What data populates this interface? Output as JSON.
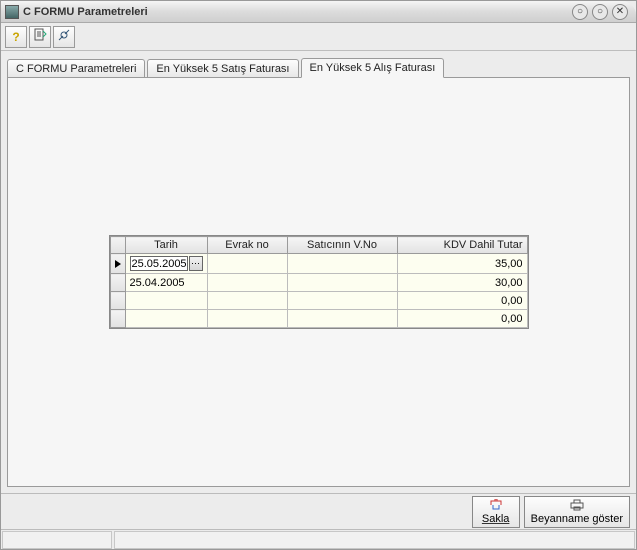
{
  "window": {
    "title": "C FORMU Parametreleri"
  },
  "toolbar": {
    "help": "?",
    "help_color": "#c9a400"
  },
  "tabs": {
    "t1": "C FORMU Parametreleri",
    "t2": "En Yüksek 5 Satış Faturası",
    "t3": "En Yüksek 5 Alış Faturası"
  },
  "grid": {
    "headers": {
      "tarih": "Tarih",
      "evrak": "Evrak no",
      "vno": "Satıcının V.No",
      "kdv": "KDV Dahil Tutar"
    },
    "rows": [
      {
        "tarih": "25.05.2005",
        "evrak": "",
        "vno": "",
        "kdv": "35,00",
        "active": true
      },
      {
        "tarih": "25.04.2005",
        "evrak": "",
        "vno": "",
        "kdv": "30,00",
        "active": false
      },
      {
        "tarih": "",
        "evrak": "",
        "vno": "",
        "kdv": "0,00",
        "active": false
      },
      {
        "tarih": "",
        "evrak": "",
        "vno": "",
        "kdv": "0,00",
        "active": false
      }
    ]
  },
  "buttons": {
    "save": "Sakla",
    "show": "Beyanname göster"
  }
}
